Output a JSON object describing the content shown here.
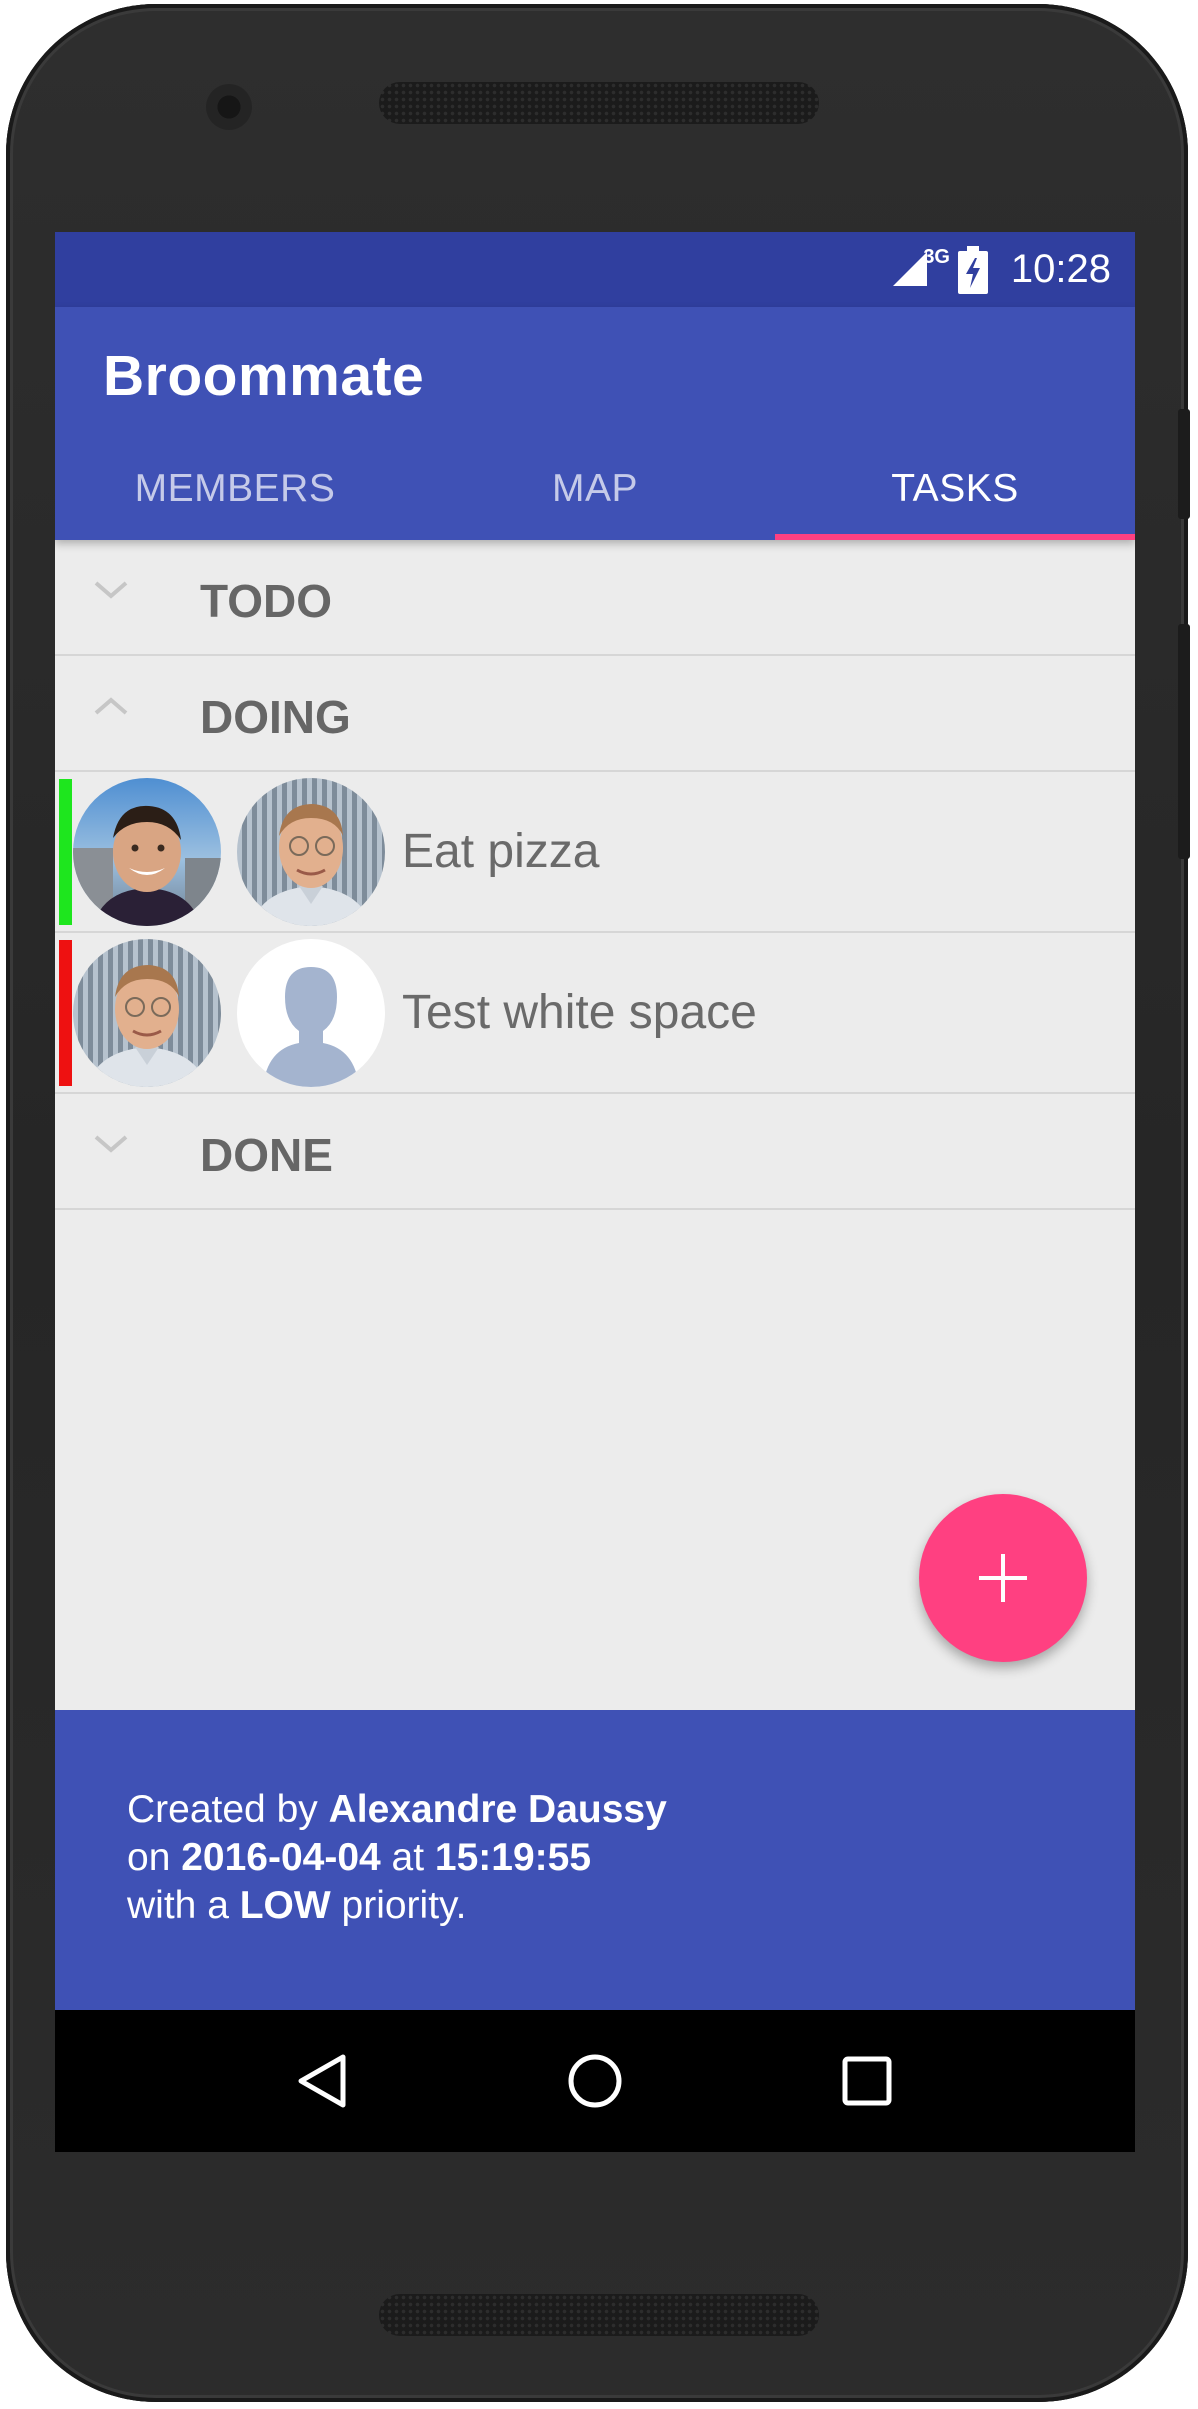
{
  "status_bar": {
    "network": "3G",
    "time": "10:28"
  },
  "app": {
    "title": "Broommate",
    "primary_color": "#3f51b5",
    "accent_color": "#ff4081"
  },
  "tabs": [
    {
      "label": "MEMBERS",
      "active": false
    },
    {
      "label": "MAP",
      "active": false
    },
    {
      "label": "TASKS",
      "active": true
    }
  ],
  "groups": [
    {
      "title": "TODO",
      "expanded": false,
      "icon": "chevron-down-icon"
    },
    {
      "title": "DOING",
      "expanded": true,
      "icon": "chevron-up-icon"
    },
    {
      "title": "DONE",
      "expanded": false,
      "icon": "chevron-down-icon"
    }
  ],
  "tasks": [
    {
      "label": "Eat pizza",
      "priority_color": "#1ee61e",
      "assignees": [
        "avatar-young-man",
        "avatar-man-glasses"
      ]
    },
    {
      "label": "Test white space",
      "priority_color": "#ee1111",
      "assignees": [
        "avatar-man-glasses",
        "avatar-placeholder"
      ]
    }
  ],
  "fab": {
    "icon": "plus-icon"
  },
  "footer": {
    "created_by_prefix": "Created by ",
    "author": "Alexandre Daussy",
    "on_prefix": "on ",
    "date": "2016-04-04",
    "at_word": " at ",
    "time": "15:19:55",
    "with_prefix": "with a ",
    "priority": "LOW",
    "priority_suffix": " priority."
  },
  "nav_bar": [
    "back-icon",
    "home-icon",
    "recents-icon"
  ]
}
